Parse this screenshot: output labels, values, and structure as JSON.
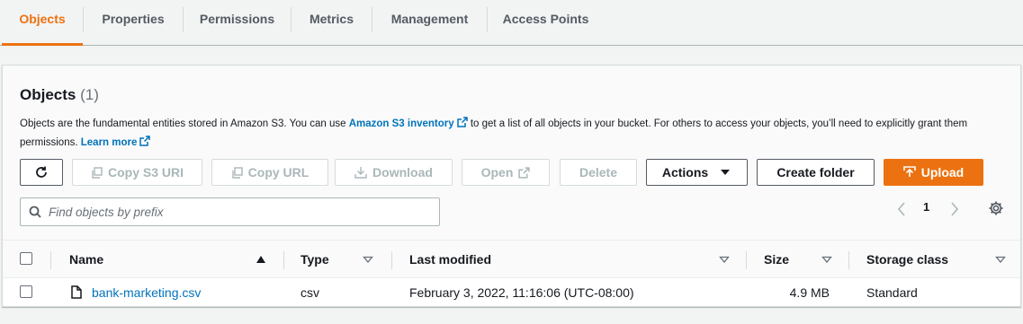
{
  "tabs": [
    {
      "label": "Objects",
      "active": true
    },
    {
      "label": "Properties"
    },
    {
      "label": "Permissions"
    },
    {
      "label": "Metrics"
    },
    {
      "label": "Management"
    },
    {
      "label": "Access Points"
    }
  ],
  "objects": {
    "title": "Objects",
    "count": "(1)",
    "description_part1": "Objects are the fundamental entities stored in Amazon S3. You can use ",
    "inventory_link": "Amazon S3 inventory",
    "description_part2": " to get a list of all objects in your bucket. For others to access your objects, you’ll need to explicitly grant them permissions. ",
    "learn_more_link": "Learn more"
  },
  "toolbar": {
    "refresh_icon": "refresh-icon",
    "copy_s3_uri": "Copy S3 URI",
    "copy_url": "Copy URL",
    "download": "Download",
    "open": "Open",
    "delete": "Delete",
    "actions": "Actions",
    "create_folder": "Create folder",
    "upload": "Upload"
  },
  "search": {
    "placeholder": "Find objects by prefix",
    "value": ""
  },
  "pagination": {
    "current_page": "1"
  },
  "table": {
    "columns": {
      "name": "Name",
      "type": "Type",
      "last_modified": "Last modified",
      "size": "Size",
      "storage_class": "Storage class"
    },
    "rows": [
      {
        "name": "bank-marketing.csv",
        "type": "csv",
        "last_modified": "February 3, 2022, 11:16:06 (UTC-08:00)",
        "size": "4.9 MB",
        "storage_class": "Standard"
      }
    ]
  },
  "colors": {
    "accent": "#ec7211",
    "link": "#0073bb",
    "text": "#16191f",
    "disabled": "#aab7b8"
  }
}
